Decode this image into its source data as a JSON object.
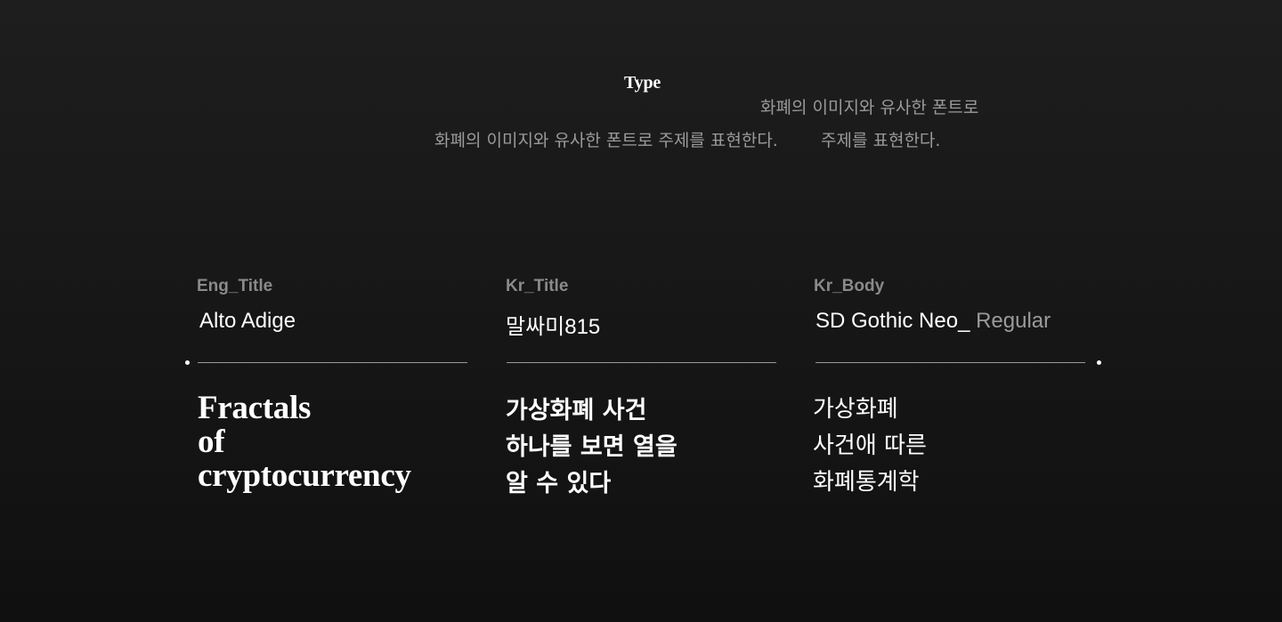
{
  "header": {
    "title": "Type",
    "description_line_1": "화폐의 이미지와 유사한 폰트로",
    "description_line_2": "화폐의 이미지와 유사한 폰트로 주제를 표현한다.",
    "description_line_3": "주제를 표현한다."
  },
  "columns": [
    {
      "label": "Eng_Title",
      "font": "Alto Adige",
      "weight": "",
      "sample_lines": [
        "Fractals",
        "of",
        "cryptocurrency"
      ]
    },
    {
      "label": "Kr_Title",
      "font": "말싸미815",
      "weight": "",
      "sample_lines": [
        "가상화폐 사건",
        "하나를 보면 열을",
        "알 수 있다"
      ]
    },
    {
      "label": "Kr_Body",
      "font": "SD Gothic Neo_",
      "weight": " Regular",
      "sample_lines": [
        "가상화폐",
        "사건애 따른",
        "화폐통계학"
      ]
    }
  ],
  "colors": {
    "background": "#1a1a1a",
    "text": "#ffffff",
    "muted": "#9a9a9a",
    "label": "#8a8a8a"
  }
}
